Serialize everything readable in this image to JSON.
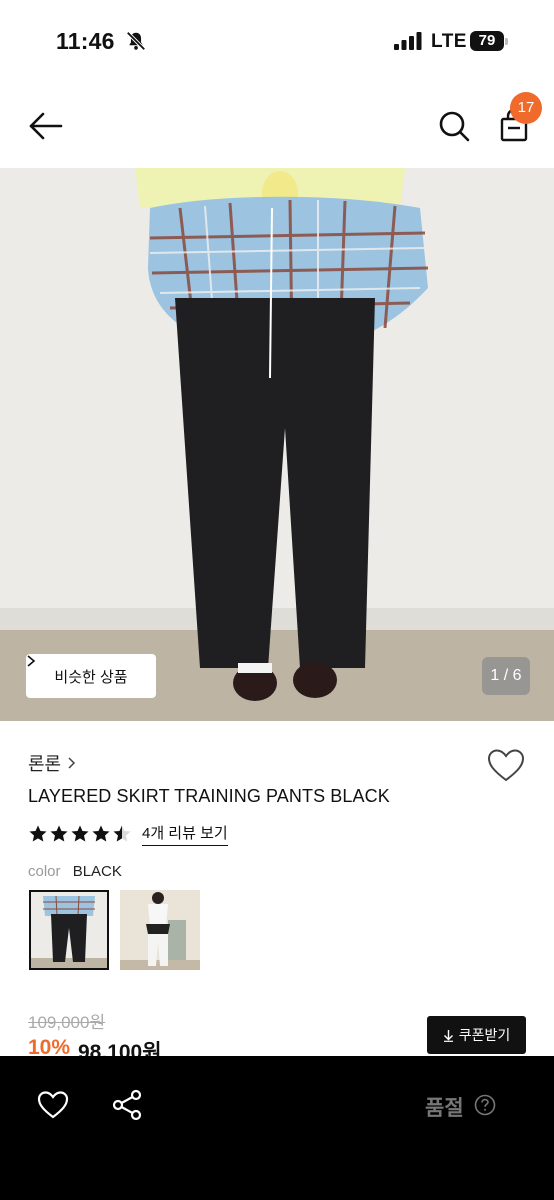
{
  "status_bar": {
    "time": "11:46",
    "network": "LTE",
    "battery": "79",
    "icons": [
      "bell-slash-icon",
      "signal-icon",
      "battery-icon"
    ]
  },
  "nav": {
    "icons": [
      "arrow-left-icon",
      "search-icon",
      "shopping-bag-icon"
    ],
    "cart_count": "17"
  },
  "hero": {
    "similar_button_label": "비슷한 상품",
    "page_counter": "1 / 6"
  },
  "product": {
    "brand": "론론",
    "name": "LAYERED SKIRT TRAINING PANTS BLACK",
    "rating": 4.5,
    "rating_max": 5,
    "review_link": "4개 리뷰 보기",
    "color_label": "color",
    "color_value": "BLACK",
    "original_price": "109,000원",
    "discount": "10%",
    "price": "98,100원",
    "coupon_button": "쿠폰받기"
  },
  "bottom_bar": {
    "status": "품절",
    "icons": [
      "heart-icon",
      "share-icon",
      "question-circle-icon"
    ]
  },
  "colors": {
    "accent": "#f06a2b",
    "bottom_bar": "#000000"
  }
}
